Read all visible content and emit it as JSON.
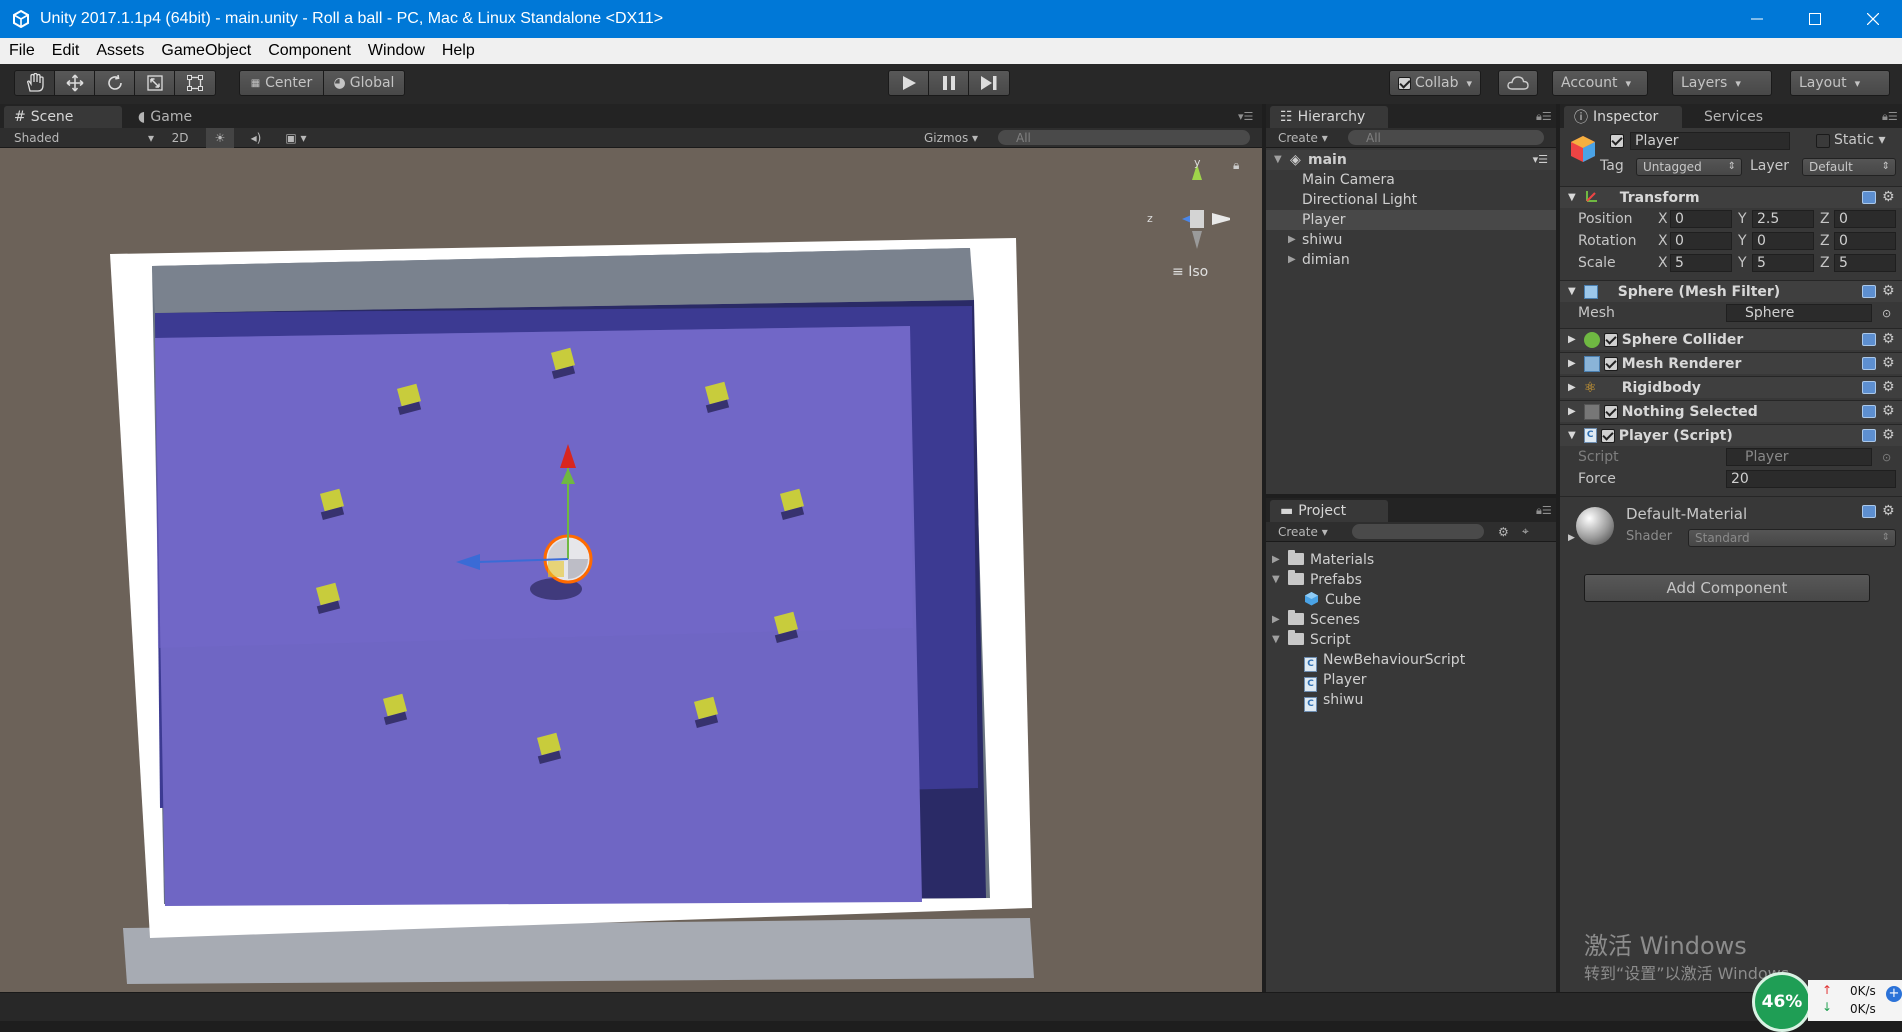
{
  "window": {
    "title": "Unity 2017.1.1p4 (64bit) - main.unity - Roll a ball - PC, Mac & Linux Standalone <DX11>"
  },
  "menu": [
    "File",
    "Edit",
    "Assets",
    "GameObject",
    "Component",
    "Window",
    "Help"
  ],
  "toolbar": {
    "pivot_label": "Center",
    "space_label": "Global",
    "collab_label": "Collab",
    "account_label": "Account",
    "layers_label": "Layers",
    "layout_label": "Layout"
  },
  "scene": {
    "tab_scene": "Scene",
    "tab_game": "Game",
    "shading": "Shaded",
    "mode_2d": "2D",
    "gizmos": "Gizmos",
    "search_placeholder": "All",
    "projection": "Iso",
    "axis_y": "y",
    "axis_z": "z"
  },
  "hierarchy": {
    "tab": "Hierarchy",
    "create": "Create",
    "search_placeholder": "All",
    "scene_name": "main",
    "items": [
      {
        "label": "Main Camera",
        "selected": false,
        "expandable": false
      },
      {
        "label": "Directional Light",
        "selected": false,
        "expandable": false
      },
      {
        "label": "Player",
        "selected": true,
        "expandable": false
      },
      {
        "label": "shiwu",
        "selected": false,
        "expandable": true
      },
      {
        "label": "dimian",
        "selected": false,
        "expandable": true
      }
    ]
  },
  "project": {
    "tab": "Project",
    "create": "Create",
    "folders": [
      {
        "label": "Materials",
        "type": "folder",
        "expanded": false,
        "depth": 0
      },
      {
        "label": "Prefabs",
        "type": "folder",
        "expanded": true,
        "depth": 0
      },
      {
        "label": "Cube",
        "type": "prefab",
        "depth": 1
      },
      {
        "label": "Scenes",
        "type": "folder",
        "expanded": false,
        "depth": 0
      },
      {
        "label": "Script",
        "type": "folder",
        "expanded": true,
        "depth": 0
      },
      {
        "label": "NewBehaviourScript",
        "type": "script",
        "depth": 1
      },
      {
        "label": "Player",
        "type": "script",
        "depth": 1
      },
      {
        "label": "shiwu",
        "type": "script",
        "depth": 1
      }
    ]
  },
  "inspector": {
    "tab": "Inspector",
    "tab_services": "Services",
    "object_name": "Player",
    "static_label": "Static",
    "tag_label": "Tag",
    "tag_value": "Untagged",
    "layer_label": "Layer",
    "layer_value": "Default",
    "transform": {
      "title": "Transform",
      "position_label": "Position",
      "rotation_label": "Rotation",
      "scale_label": "Scale",
      "axis_x": "X",
      "axis_y": "Y",
      "axis_z": "Z",
      "position": [
        "0",
        "2.5",
        "0"
      ],
      "rotation": [
        "0",
        "0",
        "0"
      ],
      "scale": [
        "5",
        "5",
        "5"
      ]
    },
    "mesh_filter": {
      "title": "Sphere (Mesh Filter)",
      "mesh_label": "Mesh",
      "mesh_value": "Sphere"
    },
    "sphere_collider": {
      "title": "Sphere Collider"
    },
    "mesh_renderer": {
      "title": "Mesh Renderer"
    },
    "rigidbody": {
      "title": "Rigidbody"
    },
    "nothing_selected": {
      "title": "Nothing Selected"
    },
    "player_script": {
      "title": "Player (Script)",
      "script_label": "Script",
      "script_value": "Player",
      "force_label": "Force",
      "force_value": "20"
    },
    "material": {
      "name": "Default-Material",
      "shader_label": "Shader",
      "shader_value": "Standard"
    },
    "add_component": "Add Component"
  },
  "watermark": {
    "line1": "激活 Windows",
    "line2": "转到“设置”以激活 Windows。"
  },
  "netmon": {
    "percent": "46%",
    "up": "0K/s",
    "down": "0K/s"
  },
  "colors": {
    "title_bar": "#0078d7",
    "floor": "#6f66c4",
    "selection": "#484848"
  }
}
